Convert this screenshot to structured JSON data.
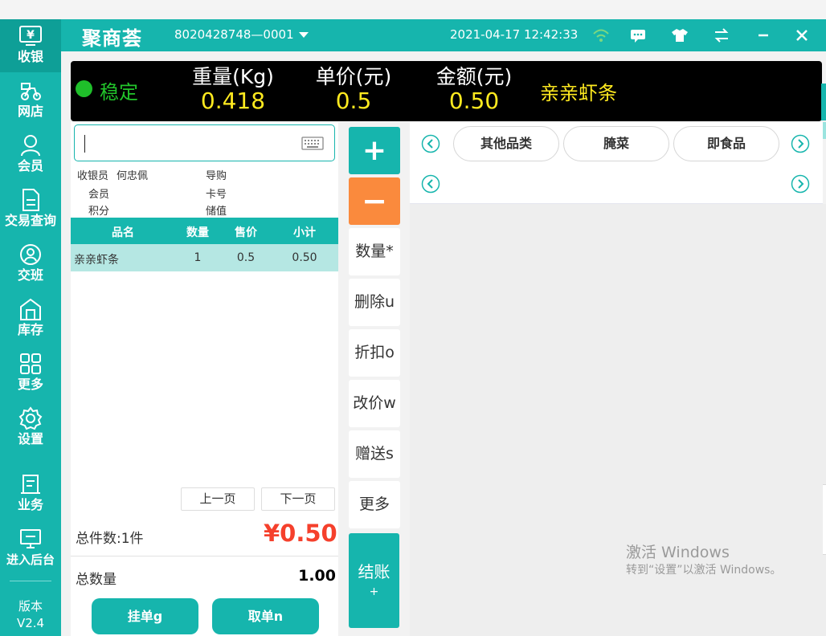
{
  "titlebar": {
    "logo": "聚商荟",
    "terminal": "8020428748—0001",
    "datetime": "2021-04-17 12:42:33",
    "icons": [
      "wifi-icon",
      "message-icon",
      "shirt-icon",
      "switch-icon",
      "minimize-icon",
      "close-icon"
    ]
  },
  "sidebar": {
    "items": [
      {
        "label": "收银",
        "icon": "cashier-icon"
      },
      {
        "label": "网店",
        "icon": "delivery-icon"
      },
      {
        "label": "会员",
        "icon": "member-icon"
      },
      {
        "label": "交易查询",
        "icon": "document-icon"
      },
      {
        "label": "交班",
        "icon": "handover-icon"
      },
      {
        "label": "库存",
        "icon": "warehouse-icon"
      },
      {
        "label": "更多",
        "icon": "grid-icon"
      },
      {
        "label": "设置",
        "icon": "gear-icon"
      },
      {
        "label": "业务",
        "icon": "business-icon"
      },
      {
        "label": "进入后台",
        "icon": "monitor-icon"
      }
    ],
    "version_label": "版本",
    "version": "V2.4"
  },
  "scale": {
    "status": "稳定",
    "weight_label": "重量(Kg)",
    "weight": "0.418",
    "price_label": "单价(元)",
    "price": "0.5",
    "amount_label": "金额(元)",
    "amount": "0.50",
    "product": "亲亲虾条"
  },
  "search": {
    "value": "",
    "icon": "keyboard-icon"
  },
  "info": {
    "cashier_label": "收银员",
    "cashier": "何忠佩",
    "guide_label": "导购",
    "member_label": "会员",
    "card_label": "卡号",
    "points_label": "积分",
    "balance_label": "储值"
  },
  "table": {
    "headers": [
      "品名",
      "数量",
      "售价",
      "小计"
    ],
    "rows": [
      {
        "name": "亲亲虾条",
        "qty": "1",
        "price": "0.5",
        "subtotal": "0.50"
      }
    ]
  },
  "pager": {
    "prev": "上一页",
    "next": "下一页"
  },
  "totals": {
    "items_label": "总件数:1件",
    "amount": "¥0.50",
    "qty_label": "总数量",
    "qty": "1.00"
  },
  "footer": {
    "hold": "挂单g",
    "retrieve": "取单n"
  },
  "actions": {
    "plus": "+",
    "minus": "−",
    "quantity": "数量*",
    "delete": "删除u",
    "discount": "折扣o",
    "reprice": "改价w",
    "gift": "赠送s",
    "more": "更多",
    "checkout": "结账",
    "checkout_key": "+"
  },
  "categories": [
    "其他品类",
    "腌菜",
    "即食品"
  ],
  "watermark": {
    "line1": "激活 Windows",
    "line2": "转到“设置”以激活 Windows。"
  },
  "colors": {
    "accent": "#16b5ad",
    "orange": "#fa8a3d",
    "price_red": "#f5402c",
    "scale_yellow": "#ffea1f",
    "stable_green": "#22c52b"
  }
}
